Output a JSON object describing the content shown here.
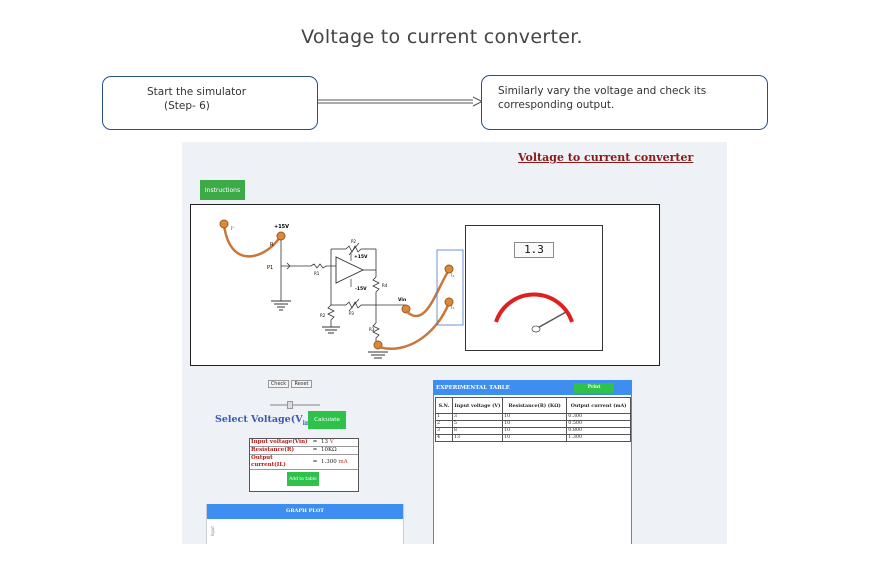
{
  "page": {
    "title": "Voltage to current converter."
  },
  "callouts": {
    "left_line1": "Start the simulator",
    "left_line2": "(Step- 6)",
    "right_line1": "Similarly vary the voltage and check its",
    "right_line2": "corresponding output."
  },
  "simulator": {
    "title": "Voltage to current converter",
    "instructions_label": "Instructions",
    "check_label": "Check",
    "reset_label": "Reset",
    "select_voltage_label": "Select Voltage(V",
    "select_voltage_sub": "in",
    "select_voltage_suffix": ") =",
    "calculate_label": "Calculate",
    "voltage_slider_level": 3,
    "meter_reading": "1.3",
    "circuit_labels": {
      "vcc_pos": "+15V",
      "vcc_pos2": "+15V",
      "vcc_neg": "-15V",
      "r": "R",
      "p1": "P1",
      "p2": "P2",
      "p3": "P3",
      "r1": "R1",
      "r2": "R2",
      "r3": "R3",
      "r4": "R4",
      "rl": "RL",
      "vin": "Vin"
    },
    "results": {
      "rows": [
        {
          "label": "Input voltage(Vin)",
          "eq": "=",
          "value": "13",
          "unit": "V"
        },
        {
          "label": "Resistance(R)",
          "eq": "=",
          "value": "10KΩ",
          "unit": ""
        },
        {
          "label": "Output current(IL)",
          "eq": "=",
          "value": "1.300",
          "unit": "mA"
        }
      ],
      "add_label": "Add to table"
    },
    "graph": {
      "title": "GRAPH PLOT",
      "axis_label": "Input"
    },
    "experimental": {
      "title": "EXPERIMENTAL TABLE",
      "print_label": "Print",
      "headers": [
        "S.N.",
        "Input voltage (V)",
        "Resistance(R) (KΩ)",
        "Output current (mA)"
      ],
      "rows": [
        [
          "1",
          "3",
          "10",
          "0.300"
        ],
        [
          "2",
          "5",
          "10",
          "0.500"
        ],
        [
          "3",
          "8",
          "10",
          "0.800"
        ],
        [
          "4",
          "13",
          "10",
          "1.300"
        ]
      ]
    }
  },
  "colors": {
    "accent_green": "#2ec24b",
    "header_blue": "#3d8ef0",
    "title_red": "#8b1a1a",
    "meter_red": "#e02020",
    "wire_orange": "#c8763a"
  }
}
